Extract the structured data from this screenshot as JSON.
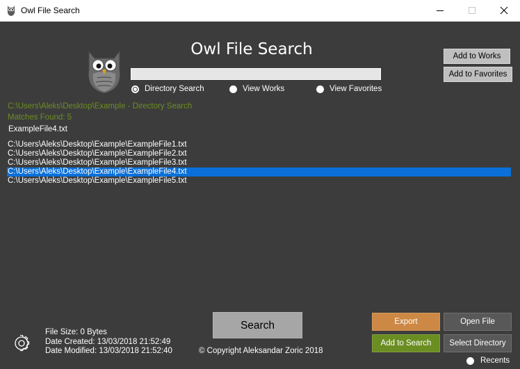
{
  "window": {
    "title": "Owl File Search"
  },
  "header": {
    "app_title": "Owl File Search",
    "search_value": ""
  },
  "modes": [
    {
      "label": "Directory Search",
      "checked": true
    },
    {
      "label": "View Works",
      "checked": false
    },
    {
      "label": "View Favorites",
      "checked": false
    }
  ],
  "side_buttons": {
    "add_to_works": "Add to Works",
    "add_to_favorites": "Add to Favorites"
  },
  "status": {
    "path_label": "C:\\Users\\Aleks\\Desktop\\Example - Directory Search",
    "matches_label": "Matches Found: 5",
    "selected_file": "ExampleFile4.txt"
  },
  "results": [
    "C:\\Users\\Aleks\\Desktop\\Example\\ExampleFile1.txt",
    "C:\\Users\\Aleks\\Desktop\\Example\\ExampleFile2.txt",
    "C:\\Users\\Aleks\\Desktop\\Example\\ExampleFile3.txt",
    "C:\\Users\\Aleks\\Desktop\\Example\\ExampleFile4.txt",
    "C:\\Users\\Aleks\\Desktop\\Example\\ExampleFile5.txt"
  ],
  "selected_result_index": 3,
  "file_info": {
    "size": "File Size: 0 Bytes",
    "created": "Date Created: 13/03/2018 21:52:49",
    "modified": "Date Modified: 13/03/2018 21:52:40"
  },
  "footer": {
    "search_label": "Search",
    "copyright": "© Copyright Aleksandar Zoric 2018",
    "export_label": "Export",
    "open_file_label": "Open File",
    "add_to_search_label": "Add to Search",
    "select_directory_label": "Select Directory",
    "recents_label": "Recents"
  },
  "colors": {
    "background": "#3c3c3c",
    "export": "#cc8844",
    "add_to_search": "#6b8e23",
    "open_file": "#585858",
    "select_directory": "#585858",
    "selection": "#0a6fd8",
    "status_text": "#6b8e23"
  },
  "icons": {
    "app": "owl-icon",
    "minimize": "minimize-icon",
    "maximize": "maximize-icon",
    "close": "close-icon",
    "settings": "gear-icon"
  }
}
